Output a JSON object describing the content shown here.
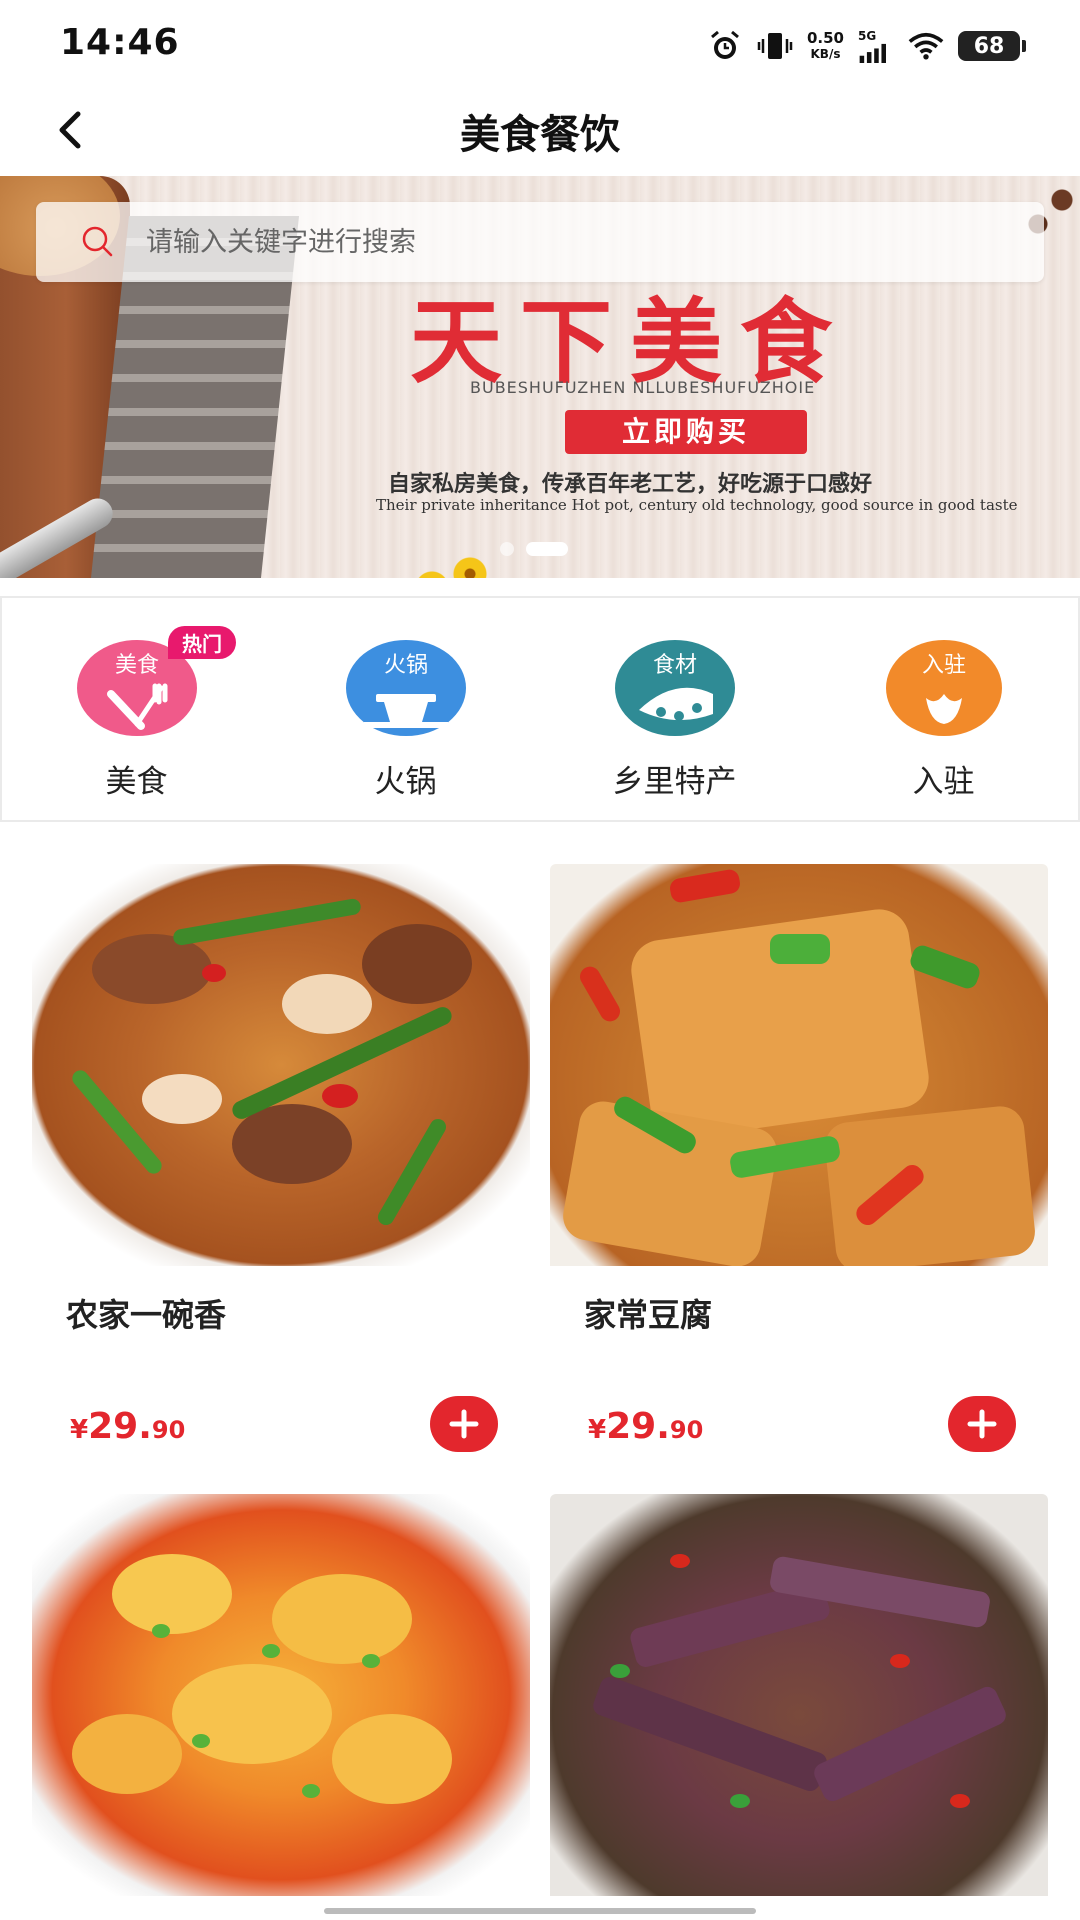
{
  "status_bar": {
    "time": "14:46",
    "net_speed_value": "0.50",
    "net_speed_unit": "KB/s",
    "signal_label": "5G",
    "battery": "68"
  },
  "nav": {
    "title": "美食餐饮"
  },
  "search": {
    "placeholder": "请输入关键字进行搜索"
  },
  "banner": {
    "headline": "天下美食",
    "pinyin": "BUBESHUFUZHEN NLLUBESHUFUZHOIE",
    "cta": "立即购买",
    "slogan": "自家私房美食，传承百年老工艺，好吃源于口感好",
    "slogan_en": "Their private inheritance Hot pot, century old technology, good source in good taste",
    "slides_total": 2,
    "active_slide": 2
  },
  "categories": [
    {
      "label": "美食",
      "icon_text": "美食",
      "icon": "cutlery-icon",
      "badge": "热门",
      "color": "#f05a8a"
    },
    {
      "label": "火锅",
      "icon_text": "火锅",
      "icon": "hotpot-icon",
      "color": "#3d8fe0"
    },
    {
      "label": "乡里特产",
      "icon_text": "食材",
      "icon": "ingredients-icon",
      "color": "#2f8b95"
    },
    {
      "label": "入驻",
      "icon_text": "入驻",
      "icon": "lotus-icon",
      "color": "#f28a2a"
    }
  ],
  "products": [
    {
      "name": "农家一碗香",
      "price_symbol": "¥",
      "price_int": "29.",
      "price_dec": "90"
    },
    {
      "name": "家常豆腐",
      "price_symbol": "¥",
      "price_int": "29.",
      "price_dec": "90"
    },
    {
      "name": "",
      "price_symbol": "",
      "price_int": "",
      "price_dec": ""
    },
    {
      "name": "",
      "price_symbol": "",
      "price_int": "",
      "price_dec": ""
    }
  ],
  "colors": {
    "accent_red": "#e3262d",
    "hot_badge": "#e8196d"
  }
}
